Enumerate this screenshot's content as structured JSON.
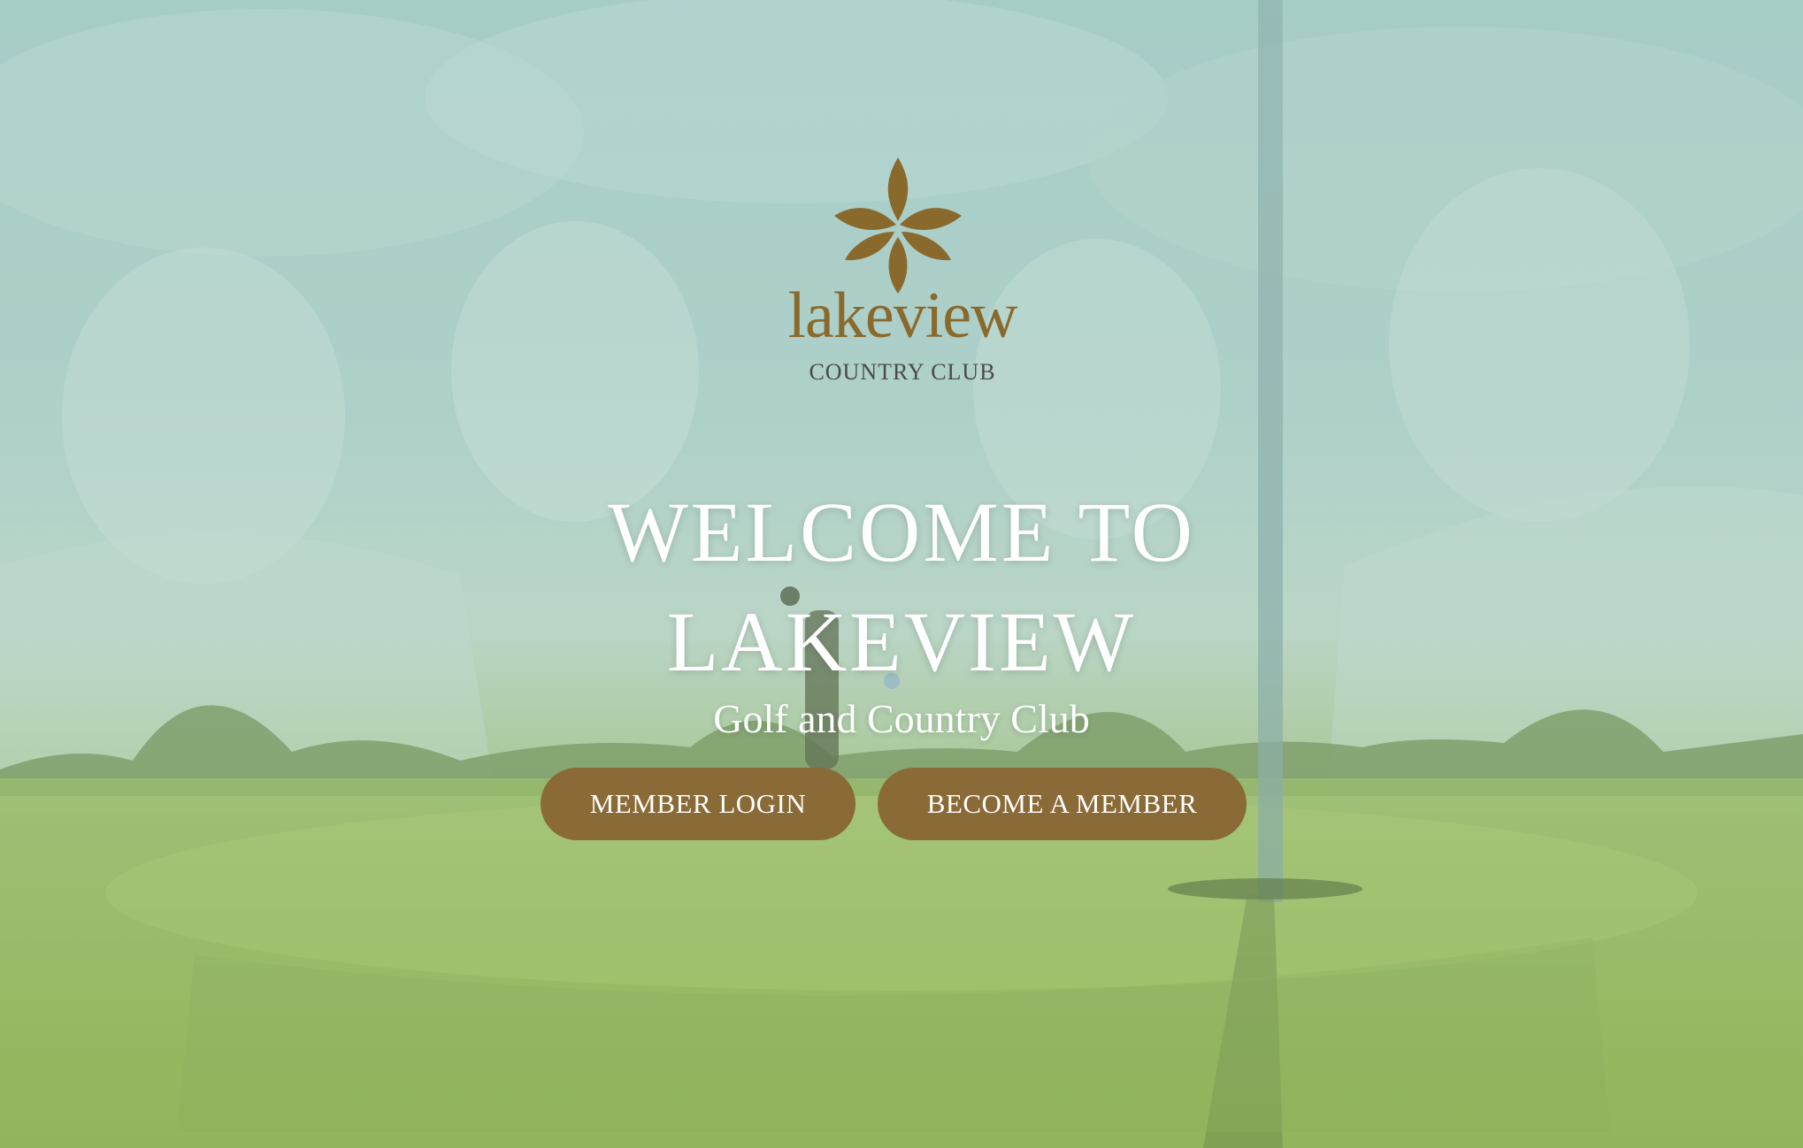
{
  "logo": {
    "wordmark": "lakeview",
    "subtitle": "COUNTRY CLUB",
    "icon": "leaf-flower-icon",
    "brand_color": "#8a6a2c"
  },
  "hero": {
    "headline": "WELCOME TO LAKEVIEW",
    "subheadline": "Golf and Country Club"
  },
  "actions": {
    "login_label": "MEMBER LOGIN",
    "join_label": "BECOME A MEMBER",
    "button_color": "#8a6a36"
  }
}
